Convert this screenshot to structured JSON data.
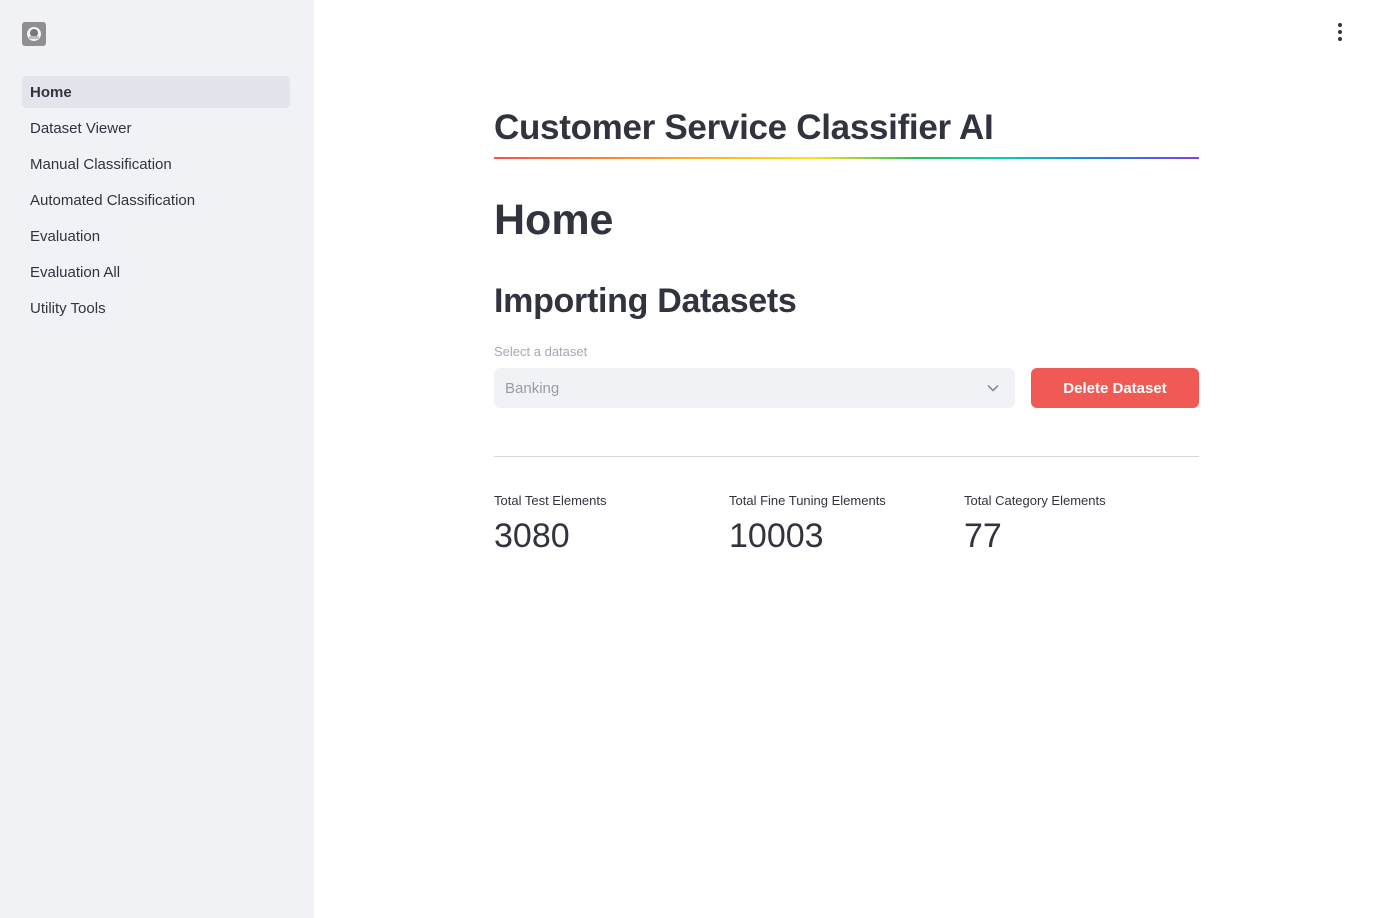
{
  "sidebar": {
    "logo_icon": "app-logo-icon",
    "items": [
      {
        "label": "Home",
        "active": true
      },
      {
        "label": "Dataset Viewer",
        "active": false
      },
      {
        "label": "Manual Classification",
        "active": false
      },
      {
        "label": "Automated Classification",
        "active": false
      },
      {
        "label": "Evaluation",
        "active": false
      },
      {
        "label": "Evaluation All",
        "active": false
      },
      {
        "label": "Utility Tools",
        "active": false
      }
    ]
  },
  "header": {
    "menu_icon": "more-vertical-icon"
  },
  "main": {
    "app_title": "Customer Service Classifier AI",
    "page_title": "Home",
    "section_title": "Importing Datasets",
    "dataset_select": {
      "label": "Select a dataset",
      "value": "Banking"
    },
    "delete_button_label": "Delete Dataset",
    "metrics": [
      {
        "label": "Total Test Elements",
        "value": "3080"
      },
      {
        "label": "Total Fine Tuning Elements",
        "value": "10003"
      },
      {
        "label": "Total Category Elements",
        "value": "77"
      }
    ]
  },
  "colors": {
    "sidebar_bg": "#f0f2f6",
    "active_item_bg": "#e2e5eb",
    "primary_button": "#ef5a55",
    "text": "#31333f"
  }
}
